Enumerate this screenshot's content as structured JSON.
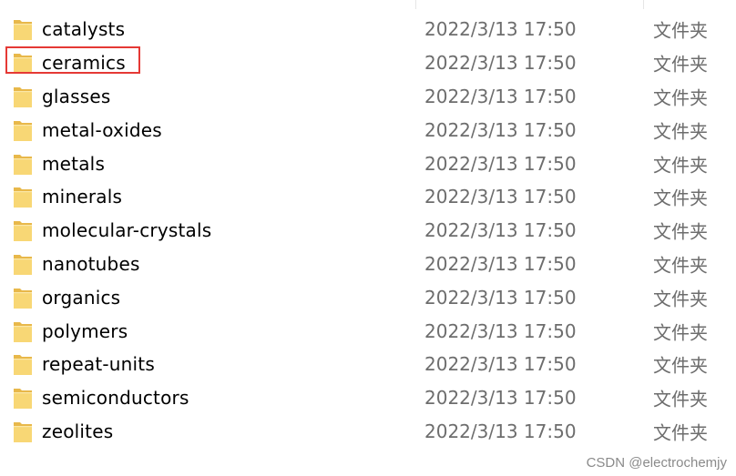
{
  "folders": [
    {
      "name": "catalysts",
      "modified": "2022/3/13 17:50",
      "type": "文件夹"
    },
    {
      "name": "ceramics",
      "modified": "2022/3/13 17:50",
      "type": "文件夹"
    },
    {
      "name": "glasses",
      "modified": "2022/3/13 17:50",
      "type": "文件夹"
    },
    {
      "name": "metal-oxides",
      "modified": "2022/3/13 17:50",
      "type": "文件夹"
    },
    {
      "name": "metals",
      "modified": "2022/3/13 17:50",
      "type": "文件夹"
    },
    {
      "name": "minerals",
      "modified": "2022/3/13 17:50",
      "type": "文件夹"
    },
    {
      "name": "molecular-crystals",
      "modified": "2022/3/13 17:50",
      "type": "文件夹"
    },
    {
      "name": "nanotubes",
      "modified": "2022/3/13 17:50",
      "type": "文件夹"
    },
    {
      "name": "organics",
      "modified": "2022/3/13 17:50",
      "type": "文件夹"
    },
    {
      "name": "polymers",
      "modified": "2022/3/13 17:50",
      "type": "文件夹"
    },
    {
      "name": "repeat-units",
      "modified": "2022/3/13 17:50",
      "type": "文件夹"
    },
    {
      "name": "semiconductors",
      "modified": "2022/3/13 17:50",
      "type": "文件夹"
    },
    {
      "name": "zeolites",
      "modified": "2022/3/13 17:50",
      "type": "文件夹"
    }
  ],
  "folder_icon": "folder-icon",
  "highlighted_folder": "ceramics",
  "highlight_color": "#e53935",
  "folder_color": "#f8d775",
  "watermark": "CSDN @electrochemjy"
}
